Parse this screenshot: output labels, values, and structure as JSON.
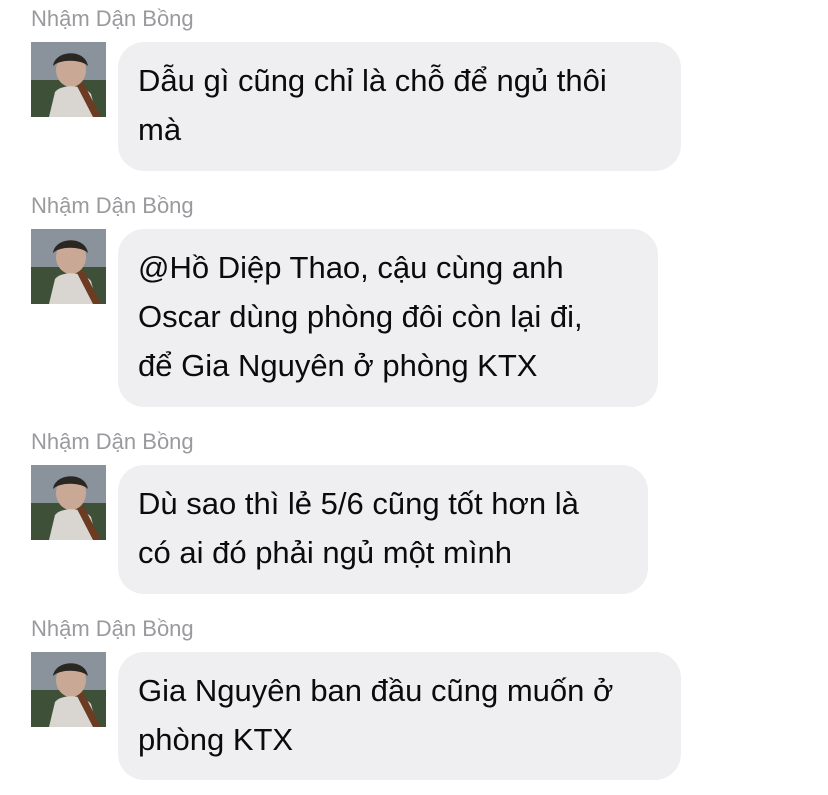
{
  "conversation": {
    "messages": [
      {
        "sender": "Nhậm Dận Bồng",
        "avatar_icon": "user-avatar-photo",
        "text": "Dẫu gì cũng chỉ là chỗ để ngủ thôi\nmà"
      },
      {
        "sender": "Nhậm Dận Bồng",
        "avatar_icon": "user-avatar-photo",
        "text": "@Hồ Diệp Thao, cậu cùng anh\nOscar dùng phòng đôi còn lại đi,\nđể Gia Nguyên ở phòng KTX"
      },
      {
        "sender": "Nhậm Dận Bồng",
        "avatar_icon": "user-avatar-photo",
        "text": "Dù sao thì lẻ 5/6 cũng tốt hơn là\ncó ai đó phải ngủ một mình"
      },
      {
        "sender": "Nhậm Dận Bồng",
        "avatar_icon": "user-avatar-photo",
        "text": "Gia Nguyên ban đầu cũng muốn ở\nphòng KTX"
      }
    ]
  },
  "colors": {
    "background": "#ffffff",
    "bubble": "#efeff1",
    "sender_name": "#9a9a9e",
    "message_text": "#0b0b0b"
  }
}
